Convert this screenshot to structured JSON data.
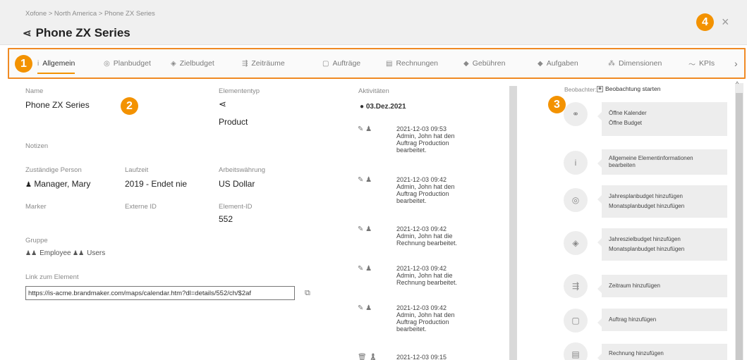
{
  "header": {
    "breadcrumb": "Xofone > North America > Phone ZX Series",
    "title": "Phone ZX Series",
    "close_label": "×"
  },
  "callouts": [
    "1",
    "2",
    "3",
    "4"
  ],
  "tabs": [
    {
      "label": "Allgemein",
      "icon": "info-icon",
      "active": true
    },
    {
      "label": "Planbudget",
      "icon": "budget-icon",
      "active": false
    },
    {
      "label": "Zielbudget",
      "icon": "target-icon",
      "active": false
    },
    {
      "label": "Zeiträume",
      "icon": "timeline-icon",
      "active": false
    },
    {
      "label": "Aufträge",
      "icon": "order-icon",
      "active": false
    },
    {
      "label": "Rechnungen",
      "icon": "invoice-icon",
      "active": false
    },
    {
      "label": "Gebühren",
      "icon": "tag-icon",
      "active": false
    },
    {
      "label": "Aufgaben",
      "icon": "task-icon",
      "active": false
    },
    {
      "label": "Dimensionen",
      "icon": "dimensions-icon",
      "active": false
    },
    {
      "label": "KPIs",
      "icon": "chart-icon",
      "active": false
    }
  ],
  "details": {
    "name_label": "Name",
    "name_value": "Phone ZX Series",
    "type_label": "Elemententyp",
    "type_value": "Product",
    "notes_label": "Notizen",
    "person_label": "Zuständige Person",
    "person_value": "Manager, Mary",
    "runtime_label": "Laufzeit",
    "runtime_value": "2019 - Endet nie",
    "currency_label": "Arbeitswährung",
    "currency_value": "US Dollar",
    "marker_label": "Marker",
    "external_id_label": "Externe ID",
    "element_id_label": "Element-ID",
    "element_id_value": "552",
    "group_label": "Gruppe",
    "groups": [
      "Employee",
      "Users"
    ],
    "link_label": "Link zum Element",
    "link_value": "https://is-acme.brandmaker.com/maps/calendar.htm?dl=details/552/ch/$2af"
  },
  "activities": {
    "title": "Aktivitäten",
    "date_header": "03.Dez.2021",
    "items": [
      {
        "time": "2021-12-03 09:53",
        "text": [
          "Admin, John hat den",
          "Auftrag Production",
          "bearbeitet."
        ]
      },
      {
        "time": "2021-12-03 09:42",
        "text": [
          "Admin, John hat den",
          "Auftrag Production",
          "bearbeitet."
        ]
      },
      {
        "time": "2021-12-03 09:42",
        "text": [
          "Admin, John hat die",
          "Rechnung bearbeitet."
        ]
      },
      {
        "time": "2021-12-03 09:42",
        "text": [
          "Admin, John hat die",
          "Rechnung bearbeitet."
        ]
      },
      {
        "time": "2021-12-03 09:42",
        "text": [
          "Admin, John hat den",
          "Auftrag Production",
          "bearbeitet."
        ]
      },
      {
        "time": "2021-12-03 09:15",
        "text": []
      }
    ]
  },
  "observer": {
    "label": "Beobachter:",
    "button": "Beobachtung starten"
  },
  "quick_actions": [
    {
      "icon": "link-icon",
      "lines": [
        "Öffne Kalender",
        "Öffne Budget"
      ]
    },
    {
      "icon": "info-icon",
      "lines": [
        "Allgemeine Elementinformationen bearbeiten"
      ]
    },
    {
      "icon": "budget-icon",
      "lines": [
        "Jahresplanbudget hinzufügen",
        "Monatsplanbudget hinzufügen"
      ]
    },
    {
      "icon": "target-icon",
      "lines": [
        "Jahreszielbudget hinzufügen",
        "Monatsplanbudget hinzufügen"
      ]
    },
    {
      "icon": "timeline-icon",
      "lines": [
        "Zeitraum hinzufügen"
      ]
    },
    {
      "icon": "order-icon",
      "lines": [
        "Auftrag hinzufügen"
      ]
    },
    {
      "icon": "invoice-icon",
      "lines": [
        "Rechnung hinzufügen"
      ]
    }
  ]
}
